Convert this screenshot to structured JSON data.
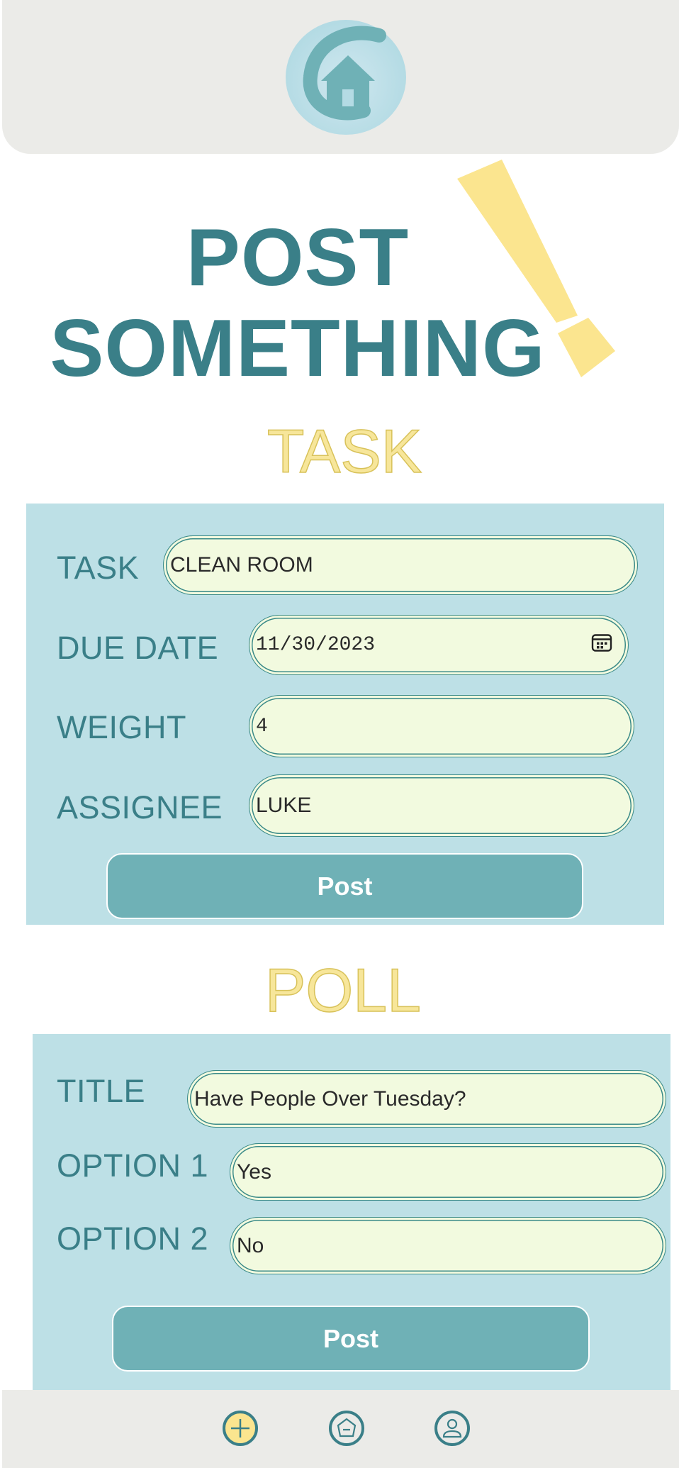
{
  "header": {
    "logo": "home-logo-icon"
  },
  "headline": {
    "line1": "POST",
    "line2": "SOMETHING"
  },
  "task_section": {
    "title": "TASK",
    "fields": {
      "task": {
        "label": "TASK",
        "value": "CLEAN ROOM"
      },
      "due_date": {
        "label": "DUE DATE",
        "value": "11/30/2023",
        "icon": "calendar-icon"
      },
      "weight": {
        "label": "WEIGHT",
        "value": "4"
      },
      "assignee": {
        "label": "ASSIGNEE",
        "value": "LUKE"
      }
    },
    "post_label": "Post"
  },
  "poll_section": {
    "title": "POLL",
    "fields": {
      "title": {
        "label": "TITLE",
        "value": "Have People Over Tuesday?"
      },
      "option1": {
        "label": "OPTION 1",
        "value": "Yes"
      },
      "option2": {
        "label": "OPTION 2",
        "value": "No"
      }
    },
    "post_label": "Post"
  },
  "navbar": {
    "items": [
      {
        "icon": "add-icon",
        "active": true
      },
      {
        "icon": "home-icon",
        "active": false
      },
      {
        "icon": "profile-icon",
        "active": false
      }
    ]
  },
  "colors": {
    "accent": "#3a7f88",
    "panel": "#bde0e6",
    "field_bg": "#f2fadf",
    "button": "#6fb1b6",
    "highlight": "#f7e69a"
  }
}
